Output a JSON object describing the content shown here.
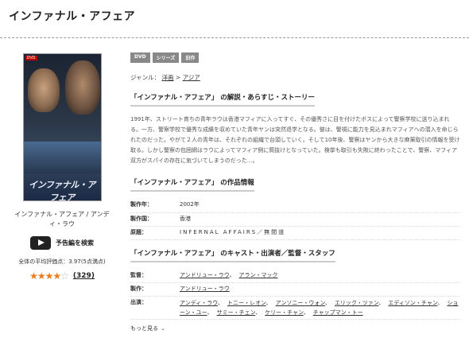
{
  "page": {
    "title": "インファナル・アフェア"
  },
  "cover": {
    "dvd_tag": "DVD",
    "title_text": "インファナル・アフェア",
    "caption": "インファナル・アフェア / アンディ・ラウ"
  },
  "trailer": {
    "label": "予告編を検索",
    "icon": "play-icon"
  },
  "rating": {
    "average_text": "全体の平均評価点：3.97(5点満点)",
    "stars": 4,
    "max": 5,
    "review_count": "329",
    "count_prefix": "(",
    "count_suffix": ")"
  },
  "badges": [
    "DVD",
    "シリーズ",
    "旧作"
  ],
  "genre": {
    "label": "ジャンル：",
    "item1": "洋画",
    "sep": ">",
    "item2": "アジア"
  },
  "story_section": {
    "heading": "「インファナル・アフェア」 の解説・あらすじ・ストーリー",
    "text": "1991年、ストリート育ちの青年ラウは香港マフィアに入ってすぐ、その優秀さに目を付けたボスによって警察学校に送り込まれる。一方、警察学校で優秀な成績を収めていた青年ヤンは突然退学となる。彼は、警視に能力を見込まれマフィアへの潜入を命じられたのだった。やがて２人の青年は、それぞれの組織で台頭していく。そして10年後、警察はヤンから大きな麻薬取引の情報を受け取る。しかし警察の包囲網はラウによってマフィア側に筒抜けとなっていた。検挙も取引も失敗に終わったことで、警察、マフィア双方がスパイの存在に気づいてしまうのだった…。"
  },
  "info_section": {
    "heading": "「インファナル・アフェア」 の作品情報",
    "rows": [
      {
        "key": "製作年：",
        "value": "2002年"
      },
      {
        "key": "製作国：",
        "value": "香港"
      },
      {
        "key": "原題：",
        "value": "INFERNAL AFFAIRS／無間道"
      }
    ]
  },
  "cast_section": {
    "heading": "「インファナル・アフェア」 のキャスト・出演者／監督・スタッフ",
    "director_label": "監督：",
    "directors": [
      "アンドリュー・ラウ",
      "アラン・マック"
    ],
    "producer_label": "製作：",
    "producers": [
      "アンドリュー・ラウ"
    ],
    "cast_label": "出演：",
    "cast": [
      "アンディ・ラウ",
      "トニー・レオン",
      "アンソニー・ウォン",
      "エリック・ツァン",
      "エディソン・チャン",
      "ショーン・ユー",
      "サミー・チェン",
      "ケリー・チャン",
      "チャップマン・トー"
    ],
    "more_label": "もっと見る"
  }
}
